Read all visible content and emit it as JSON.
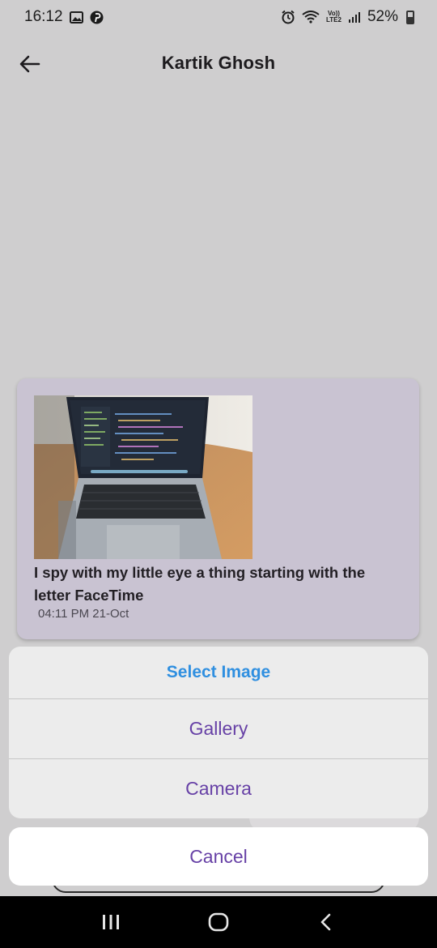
{
  "status_bar": {
    "time": "16:12",
    "battery": "52%",
    "icons": [
      "gallery-icon",
      "pinterest-icon",
      "alarm-icon",
      "wifi-calling-icon",
      "volte-icon",
      "signal-icon",
      "battery-icon"
    ],
    "volte_label": "Vo))",
    "lte_label": "LTE2"
  },
  "app_bar": {
    "title": "Kartik Ghosh",
    "back_icon": "arrow-left-icon"
  },
  "message": {
    "text": "I spy with my little eye a thing starting with the letter FaceTime",
    "timestamp": "04:11 PM 21-Oct",
    "image_subject": "laptop-photo"
  },
  "action_sheet": {
    "title": "Select Image",
    "options": [
      "Gallery",
      "Camera"
    ],
    "cancel_label": "Cancel"
  },
  "colors": {
    "background": "#cfcecf",
    "card": "#c9c3d2",
    "sheet": "#ececec",
    "accent_title": "#2f8fe0",
    "option_text": "#6741a6"
  },
  "nav_bar": {
    "icons": [
      "recent-apps-icon",
      "home-icon",
      "back-nav-icon"
    ]
  }
}
